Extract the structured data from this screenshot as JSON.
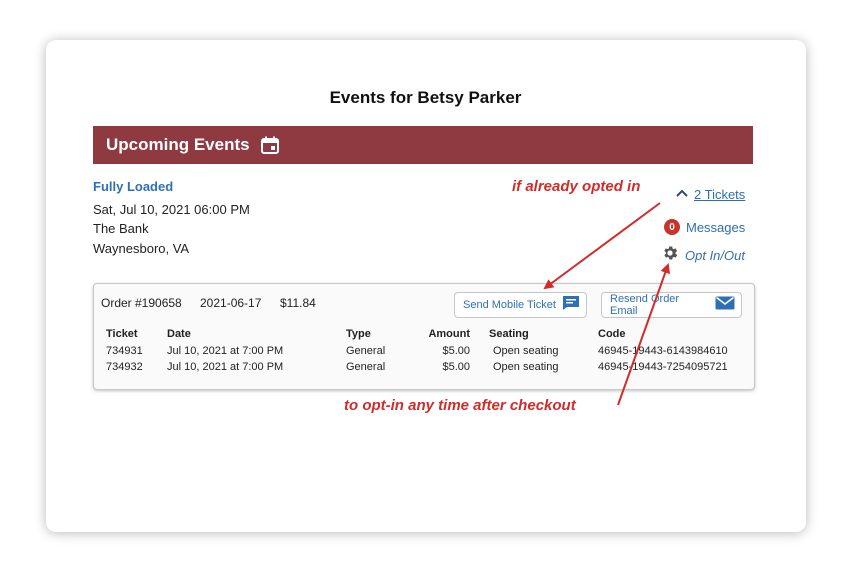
{
  "page": {
    "title": "Events for Betsy Parker"
  },
  "banner": {
    "label": "Upcoming Events",
    "icon": "calendar-icon"
  },
  "event": {
    "name": "Fully Loaded",
    "datetime": "Sat, Jul 10, 2021 06:00 PM",
    "venue": "The Bank",
    "location": "Waynesboro, VA"
  },
  "actions": {
    "tickets_label": "2 Tickets",
    "messages_count": "0",
    "messages_label": "Messages",
    "optin_label": "Opt In/Out"
  },
  "order": {
    "number": "Order #190658",
    "date": "2021-06-17",
    "total": "$11.84",
    "send_mobile_label": "Send Mobile Ticket",
    "resend_email_label": "Resend Order Email",
    "columns": [
      "Ticket",
      "Date",
      "Type",
      "Amount",
      "Seating",
      "Code"
    ],
    "rows": [
      [
        "734931",
        "Jul 10, 2021 at 7:00 PM",
        "General",
        "$5.00",
        "Open seating",
        "46945-19443-6143984610"
      ],
      [
        "734932",
        "Jul 10, 2021 at 7:00 PM",
        "General",
        "$5.00",
        "Open seating",
        "46945-19443-7254095721"
      ]
    ]
  },
  "annotations": {
    "opted_in": "if already opted in",
    "opt_in_anytime": "to opt-in any time after checkout",
    "color": "#d22b2b"
  },
  "colors": {
    "banner": "#8e3a40",
    "link": "#2e6fb6",
    "badge": "#c8342b"
  }
}
